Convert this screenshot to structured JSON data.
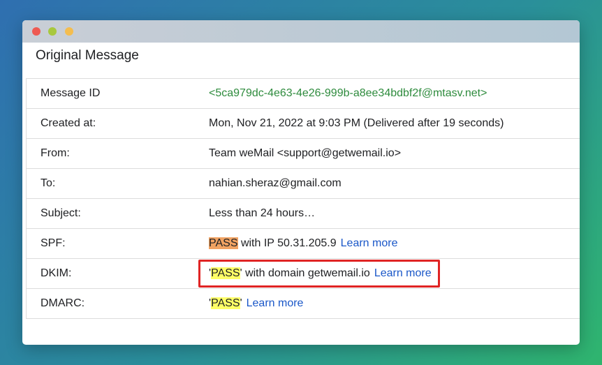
{
  "heading": "Original Message",
  "rows": [
    {
      "label": "Message ID",
      "value": "<5ca979dc-4e63-4e26-999b-a8ee34bdbf2f@mtasv.net>"
    },
    {
      "label": "Created at:",
      "value": "Mon, Nov 21, 2022 at 9:03 PM (Delivered after 19 seconds)"
    },
    {
      "label": "From:",
      "value": "Team weMail <support@getwemail.io>"
    },
    {
      "label": "To:",
      "value": "nahian.sheraz@gmail.com"
    },
    {
      "label": "Subject:",
      "value": "Less than 24 hours…"
    }
  ],
  "spf": {
    "label": "SPF:",
    "status": "PASS",
    "detail": " with IP 50.31.205.9",
    "link": "Learn more"
  },
  "dkim": {
    "label": "DKIM:",
    "quote": "'",
    "status": "PASS",
    "detail": "' with domain getwemail.io",
    "link": "Learn more"
  },
  "dmarc": {
    "label": "DMARC:",
    "quote": "'",
    "status": "PASS",
    "detail": "'",
    "link": "Learn more"
  },
  "colors": {
    "pass_orange": "#f0a262",
    "pass_yellow": "#ffff66",
    "link": "#1a57c8",
    "message_id": "#2e8b3d",
    "highlight": "#e02424"
  }
}
